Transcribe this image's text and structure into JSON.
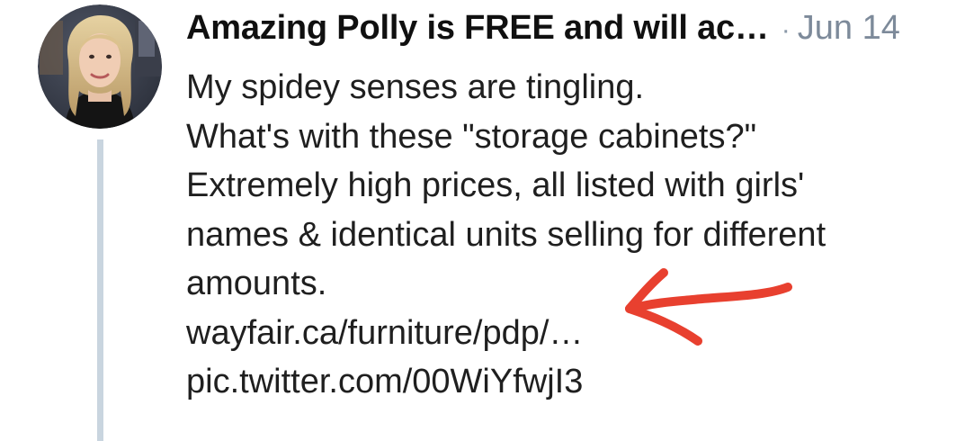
{
  "tweet": {
    "author_name": "Amazing Polly is FREE and will ac…",
    "separator": "·",
    "date": "Jun 14",
    "text_lines": [
      "My spidey senses are tingling.",
      "What's with these \"storage cabinets?\"",
      "Extremely high prices, all listed with girls'",
      "names & identical units selling for different",
      "amounts."
    ],
    "link_url_text": "wayfair.ca/furniture/pdp/…",
    "pic_link_text": "pic.twitter.com/00WiYfwjI3"
  },
  "icons": {
    "avatar": "profile-photo",
    "annotation": "hand-drawn-red-arrow"
  },
  "colors": {
    "background": "#ffffff",
    "text": "#1f1f1f",
    "muted": "#7d8a9a",
    "thread_line": "#c9d5df",
    "annotation_arrow": "#e8402f"
  }
}
